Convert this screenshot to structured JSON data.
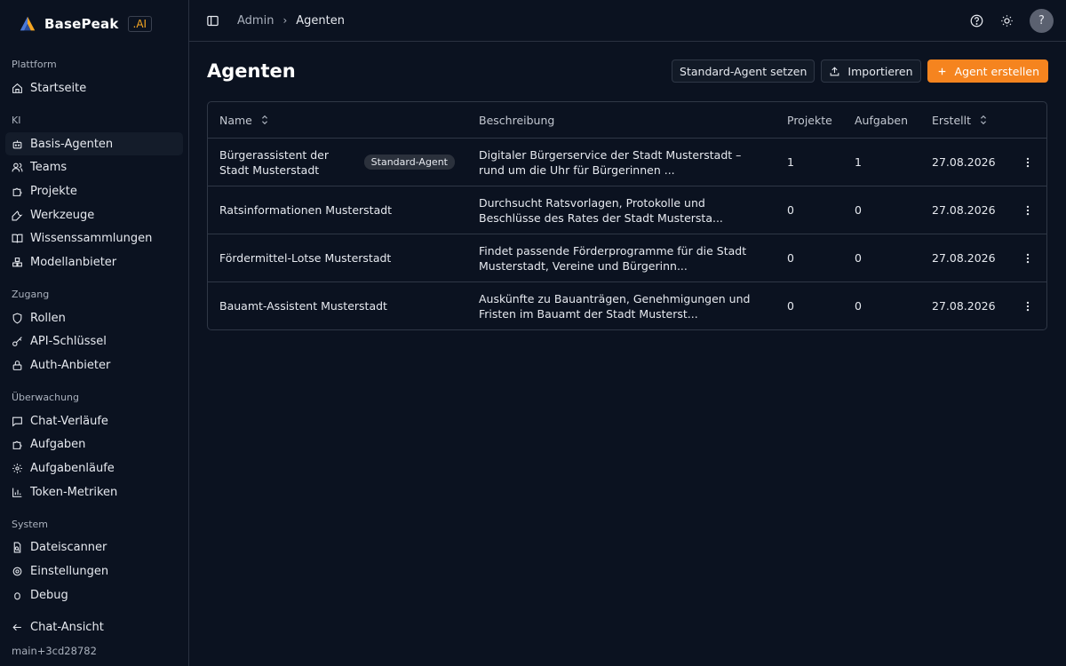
{
  "brand": {
    "name": "BasePeak",
    "suffix": ".AI"
  },
  "sidebar": {
    "sections": [
      {
        "title": "Plattform",
        "items": [
          {
            "label": "Startseite",
            "icon": "home-icon"
          }
        ]
      },
      {
        "title": "KI",
        "items": [
          {
            "label": "Basis-Agenten",
            "icon": "bot-icon",
            "active": true
          },
          {
            "label": "Teams",
            "icon": "users-icon"
          },
          {
            "label": "Projekte",
            "icon": "puzzle-icon"
          },
          {
            "label": "Werkzeuge",
            "icon": "wrench-icon"
          },
          {
            "label": "Wissenssammlungen",
            "icon": "book-icon"
          },
          {
            "label": "Modellanbieter",
            "icon": "boxes-icon"
          }
        ]
      },
      {
        "title": "Zugang",
        "items": [
          {
            "label": "Rollen",
            "icon": "shield-icon"
          },
          {
            "label": "API-Schlüssel",
            "icon": "key-icon"
          },
          {
            "label": "Auth-Anbieter",
            "icon": "lock-icon"
          }
        ]
      },
      {
        "title": "Überwachung",
        "items": [
          {
            "label": "Chat-Verläufe",
            "icon": "message-icon"
          },
          {
            "label": "Aufgaben",
            "icon": "puzzle-icon"
          },
          {
            "label": "Aufgabenläufe",
            "icon": "settings-cog-icon"
          },
          {
            "label": "Token-Metriken",
            "icon": "bar-chart-icon"
          }
        ]
      },
      {
        "title": "System",
        "items": [
          {
            "label": "Dateiscanner",
            "icon": "file-scan-icon"
          },
          {
            "label": "Einstellungen",
            "icon": "gear-icon"
          },
          {
            "label": "Debug",
            "icon": "bug-icon"
          }
        ]
      }
    ],
    "footer": {
      "chat_view": "Chat-Ansicht",
      "version": "main+3cd28782"
    }
  },
  "topbar": {
    "breadcrumb": {
      "root": "Admin",
      "current": "Agenten"
    },
    "avatar": "?"
  },
  "page": {
    "title": "Agenten",
    "actions": {
      "set_default": "Standard-Agent setzen",
      "import": "Importieren",
      "create": "Agent erstellen"
    }
  },
  "table": {
    "columns": {
      "name": "Name",
      "description": "Beschreibung",
      "projects": "Projekte",
      "tasks": "Aufgaben",
      "created": "Erstellt"
    },
    "rows": [
      {
        "name": "Bürgerassistent der Stadt Musterstadt",
        "badge": "Standard-Agent",
        "description": "Digitaler Bürgerservice der Stadt Musterstadt – rund um die Uhr für Bürgerinnen ...",
        "projects": "1",
        "tasks": "1",
        "created": "27.08.2026"
      },
      {
        "name": "Ratsinformationen Musterstadt",
        "badge": "",
        "description": "Durchsucht Ratsvorlagen, Protokolle und Beschlüsse des Rates der Stadt Mustersta...",
        "projects": "0",
        "tasks": "0",
        "created": "27.08.2026"
      },
      {
        "name": "Fördermittel-Lotse Musterstadt",
        "badge": "",
        "description": "Findet passende Förderprogramme für die Stadt Musterstadt, Vereine und Bürgerinn...",
        "projects": "0",
        "tasks": "0",
        "created": "27.08.2026"
      },
      {
        "name": "Bauamt-Assistent Musterstadt",
        "badge": "",
        "description": "Auskünfte zu Bauanträgen, Genehmigungen und Fristen im Bauamt der Stadt Musterst...",
        "projects": "0",
        "tasks": "0",
        "created": "27.08.2026"
      }
    ]
  },
  "colors": {
    "accent": "#f5841f",
    "background": "#0b1220",
    "border": "#2f3746"
  }
}
